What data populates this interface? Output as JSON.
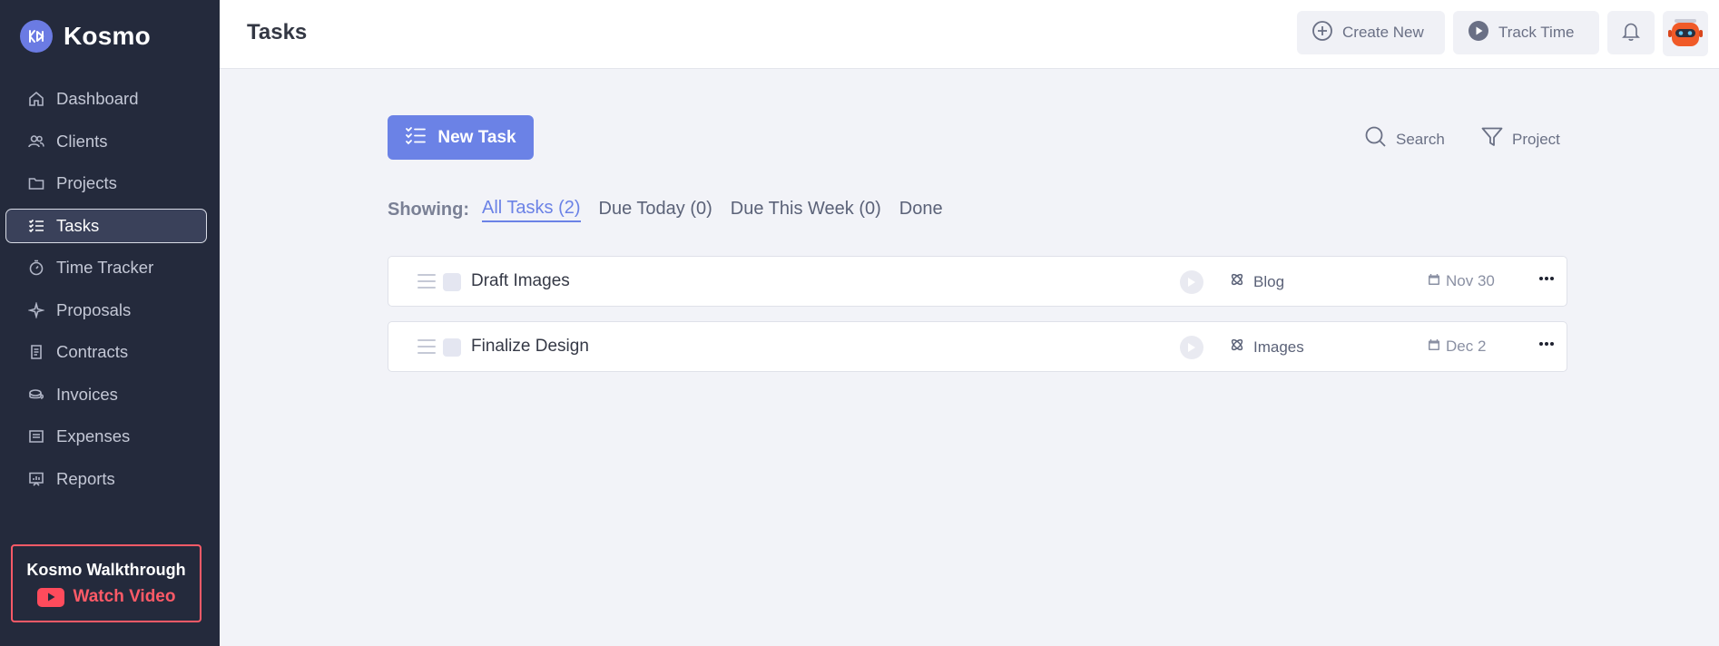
{
  "brand": {
    "name": "Kosmo"
  },
  "sidebar": {
    "items": [
      {
        "label": "Dashboard",
        "icon": "home-icon"
      },
      {
        "label": "Clients",
        "icon": "users-icon"
      },
      {
        "label": "Projects",
        "icon": "folder-icon"
      },
      {
        "label": "Tasks",
        "icon": "checklist-icon",
        "active": true
      },
      {
        "label": "Time Tracker",
        "icon": "stopwatch-icon"
      },
      {
        "label": "Proposals",
        "icon": "sparkle-icon"
      },
      {
        "label": "Contracts",
        "icon": "contract-icon"
      },
      {
        "label": "Invoices",
        "icon": "coins-icon"
      },
      {
        "label": "Expenses",
        "icon": "receipt-icon"
      },
      {
        "label": "Reports",
        "icon": "presentation-chart-icon"
      }
    ],
    "walkthrough": {
      "title": "Kosmo Walkthrough",
      "cta": "Watch Video"
    }
  },
  "header": {
    "title": "Tasks",
    "create_new": "Create New",
    "track_time": "Track Time"
  },
  "toolbar": {
    "new_task": "New Task",
    "search": "Search",
    "project": "Project"
  },
  "filters": {
    "showing_label": "Showing:",
    "tabs": [
      {
        "label": "All Tasks (2)",
        "active": true
      },
      {
        "label": "Due Today (0)"
      },
      {
        "label": "Due This Week (0)"
      },
      {
        "label": "Done"
      }
    ]
  },
  "tasks": [
    {
      "title": "Draft Images",
      "project": "Blog",
      "due": "Nov 30"
    },
    {
      "title": "Finalize Design",
      "project": "Images",
      "due": "Dec 2"
    }
  ],
  "colors": {
    "sidebar_bg": "#242a3c",
    "accent": "#6b82e6",
    "walkthrough_red": "#ff5a67",
    "page_bg": "#f2f3f8"
  }
}
